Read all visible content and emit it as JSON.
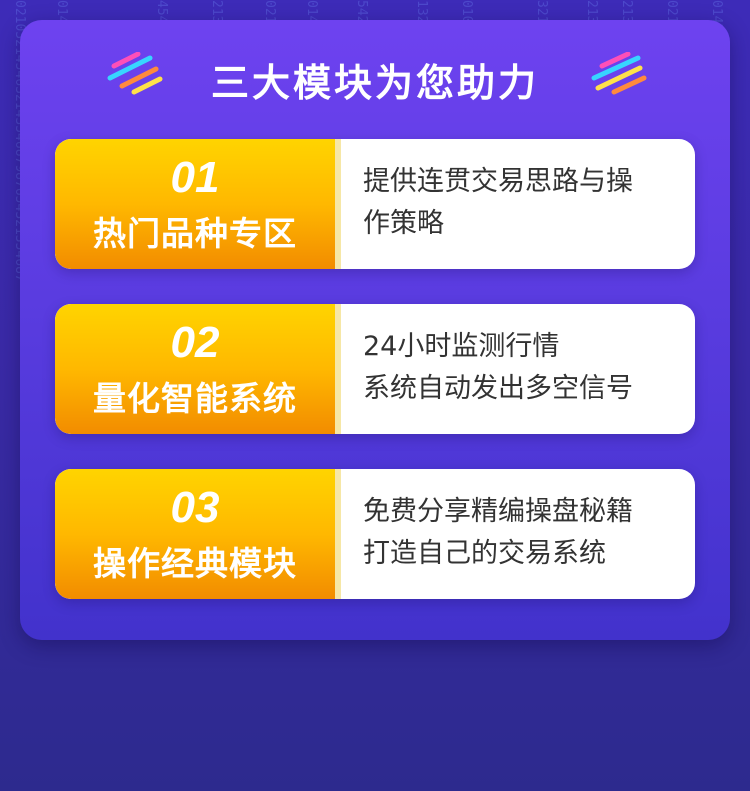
{
  "header": {
    "title": "三大模块为您助力"
  },
  "modules": [
    {
      "number": "01",
      "name": "热门品种专区",
      "desc_line1": "提供连贯交易思路与操",
      "desc_line2": "作策略"
    },
    {
      "number": "02",
      "name": "量化智能系统",
      "desc_line1": "24小时监测行情",
      "desc_line2": "系统自动发出多空信号"
    },
    {
      "number": "03",
      "name": "操作经典模块",
      "desc_line1": "免费分享精编操盘秘籍",
      "desc_line2": "打造自己的交易系统"
    }
  ],
  "colors": {
    "background": "#3a2aa6",
    "panel_top": "#6e42f0",
    "panel_bottom": "#4232cc",
    "tag_top": "#ffd400",
    "tag_bottom": "#f28c00",
    "desc_text": "#333333"
  },
  "icons": {
    "title_deco_left": "stripes-icon",
    "title_deco_right": "stripes-icon"
  }
}
